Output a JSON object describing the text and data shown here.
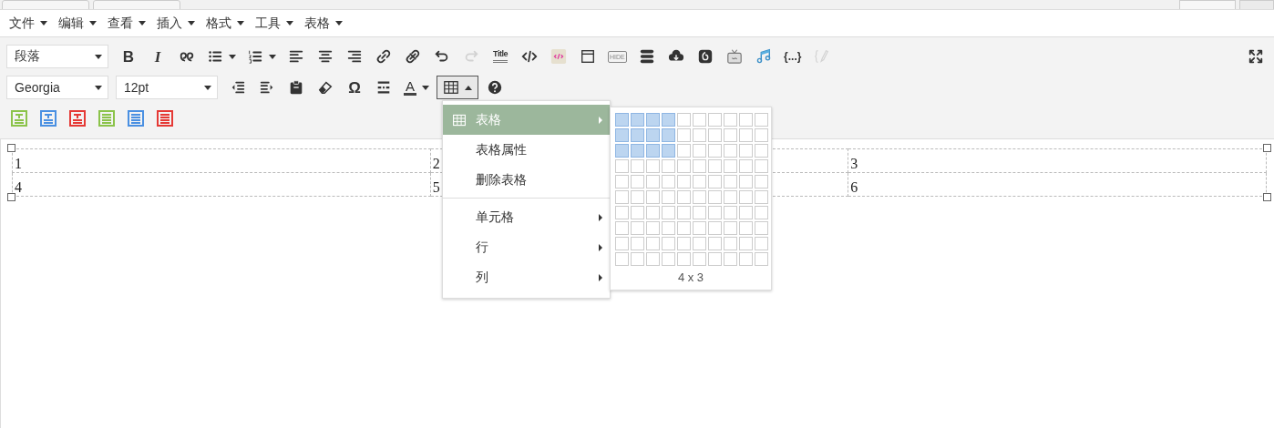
{
  "menubar": [
    {
      "label": "文件"
    },
    {
      "label": "编辑"
    },
    {
      "label": "查看"
    },
    {
      "label": "插入"
    },
    {
      "label": "格式"
    },
    {
      "label": "工具"
    },
    {
      "label": "表格"
    }
  ],
  "toolbar_1": {
    "block_format": "段落",
    "buttons": [
      {
        "kind": "bold",
        "label": "B",
        "disabled": false
      },
      {
        "kind": "italic",
        "label": "I",
        "disabled": false
      },
      {
        "kind": "quote",
        "disabled": false
      },
      {
        "kind": "bullets",
        "disabled": false
      },
      {
        "kind": "numbers",
        "disabled": false
      },
      {
        "kind": "align-left",
        "disabled": false
      },
      {
        "kind": "align-center",
        "disabled": false
      },
      {
        "kind": "align-right",
        "disabled": false
      },
      {
        "kind": "link",
        "disabled": false
      },
      {
        "kind": "unlink",
        "disabled": false
      },
      {
        "kind": "undo",
        "disabled": false
      },
      {
        "kind": "redo",
        "disabled": true
      },
      {
        "kind": "title",
        "label": "Title",
        "disabled": false
      },
      {
        "kind": "code",
        "disabled": false
      },
      {
        "kind": "highlight",
        "disabled": false
      },
      {
        "kind": "window",
        "disabled": false
      },
      {
        "kind": "hide",
        "label": "HIDE",
        "disabled": false
      },
      {
        "kind": "stack",
        "disabled": false
      },
      {
        "kind": "cloud",
        "disabled": false
      },
      {
        "kind": "spiral",
        "disabled": false
      },
      {
        "kind": "tv",
        "disabled": false
      },
      {
        "kind": "music",
        "disabled": false
      },
      {
        "kind": "braces",
        "label": "{...}",
        "disabled": false
      },
      {
        "kind": "edit-braces",
        "disabled": true
      }
    ]
  },
  "toolbar_2": {
    "font_family": "Georgia",
    "font_size": "12pt",
    "buttons": [
      {
        "kind": "outdent",
        "disabled": false
      },
      {
        "kind": "indent",
        "disabled": false
      },
      {
        "kind": "paste",
        "disabled": false
      },
      {
        "kind": "eraser",
        "disabled": false
      },
      {
        "kind": "omega",
        "label": "Ω",
        "disabled": false
      },
      {
        "kind": "pagebreak",
        "disabled": false
      },
      {
        "kind": "textcolor",
        "label": "A",
        "disabled": false
      },
      {
        "kind": "table",
        "disabled": false,
        "active": true
      },
      {
        "kind": "help",
        "disabled": false
      }
    ]
  },
  "toolbar_3": [
    {
      "kind": "title-box",
      "color": "#8bc34a"
    },
    {
      "kind": "title-box",
      "color": "#4a90e2"
    },
    {
      "kind": "title-box",
      "color": "#e53935"
    },
    {
      "kind": "list-box",
      "color": "#8bc34a"
    },
    {
      "kind": "list-box",
      "color": "#4a90e2"
    },
    {
      "kind": "list-box",
      "color": "#e53935"
    }
  ],
  "table": {
    "rows": [
      [
        "1",
        "2",
        "3"
      ],
      [
        "4",
        "5",
        "6"
      ]
    ]
  },
  "table_menu": {
    "items": [
      {
        "label": "表格",
        "selected": true,
        "submenu": true,
        "icon": true
      },
      {
        "label": "表格属性",
        "selected": false,
        "submenu": false
      },
      {
        "label": "删除表格",
        "selected": false,
        "submenu": false,
        "divider_after": true
      },
      {
        "label": "单元格",
        "selected": false,
        "submenu": true
      },
      {
        "label": "行",
        "selected": false,
        "submenu": true
      },
      {
        "label": "列",
        "selected": false,
        "submenu": true
      }
    ]
  },
  "table_picker": {
    "size_label": "4 x 3",
    "rows": [
      {
        "cells": [
          {
            "selected": true
          },
          {
            "selected": true
          },
          {
            "selected": true
          },
          {
            "selected": true
          },
          {
            "selected": false
          },
          {
            "selected": false
          },
          {
            "selected": false
          },
          {
            "selected": false
          },
          {
            "selected": false
          },
          {
            "selected": false
          }
        ]
      },
      {
        "cells": [
          {
            "selected": true
          },
          {
            "selected": true
          },
          {
            "selected": true
          },
          {
            "selected": true
          },
          {
            "selected": false
          },
          {
            "selected": false
          },
          {
            "selected": false
          },
          {
            "selected": false
          },
          {
            "selected": false
          },
          {
            "selected": false
          }
        ]
      },
      {
        "cells": [
          {
            "selected": true
          },
          {
            "selected": true
          },
          {
            "selected": true
          },
          {
            "selected": true
          },
          {
            "selected": false
          },
          {
            "selected": false
          },
          {
            "selected": false
          },
          {
            "selected": false
          },
          {
            "selected": false
          },
          {
            "selected": false
          }
        ]
      },
      {
        "cells": [
          {
            "selected": false
          },
          {
            "selected": false
          },
          {
            "selected": false
          },
          {
            "selected": false
          },
          {
            "selected": false
          },
          {
            "selected": false
          },
          {
            "selected": false
          },
          {
            "selected": false
          },
          {
            "selected": false
          },
          {
            "selected": false
          }
        ]
      },
      {
        "cells": [
          {
            "selected": false
          },
          {
            "selected": false
          },
          {
            "selected": false
          },
          {
            "selected": false
          },
          {
            "selected": false
          },
          {
            "selected": false
          },
          {
            "selected": false
          },
          {
            "selected": false
          },
          {
            "selected": false
          },
          {
            "selected": false
          }
        ]
      },
      {
        "cells": [
          {
            "selected": false
          },
          {
            "selected": false
          },
          {
            "selected": false
          },
          {
            "selected": false
          },
          {
            "selected": false
          },
          {
            "selected": false
          },
          {
            "selected": false
          },
          {
            "selected": false
          },
          {
            "selected": false
          },
          {
            "selected": false
          }
        ]
      },
      {
        "cells": [
          {
            "selected": false
          },
          {
            "selected": false
          },
          {
            "selected": false
          },
          {
            "selected": false
          },
          {
            "selected": false
          },
          {
            "selected": false
          },
          {
            "selected": false
          },
          {
            "selected": false
          },
          {
            "selected": false
          },
          {
            "selected": false
          }
        ]
      },
      {
        "cells": [
          {
            "selected": false
          },
          {
            "selected": false
          },
          {
            "selected": false
          },
          {
            "selected": false
          },
          {
            "selected": false
          },
          {
            "selected": false
          },
          {
            "selected": false
          },
          {
            "selected": false
          },
          {
            "selected": false
          },
          {
            "selected": false
          }
        ]
      },
      {
        "cells": [
          {
            "selected": false
          },
          {
            "selected": false
          },
          {
            "selected": false
          },
          {
            "selected": false
          },
          {
            "selected": false
          },
          {
            "selected": false
          },
          {
            "selected": false
          },
          {
            "selected": false
          },
          {
            "selected": false
          },
          {
            "selected": false
          }
        ]
      },
      {
        "cells": [
          {
            "selected": false
          },
          {
            "selected": false
          },
          {
            "selected": false
          },
          {
            "selected": false
          },
          {
            "selected": false
          },
          {
            "selected": false
          },
          {
            "selected": false
          },
          {
            "selected": false
          },
          {
            "selected": false
          },
          {
            "selected": false
          }
        ]
      }
    ]
  }
}
